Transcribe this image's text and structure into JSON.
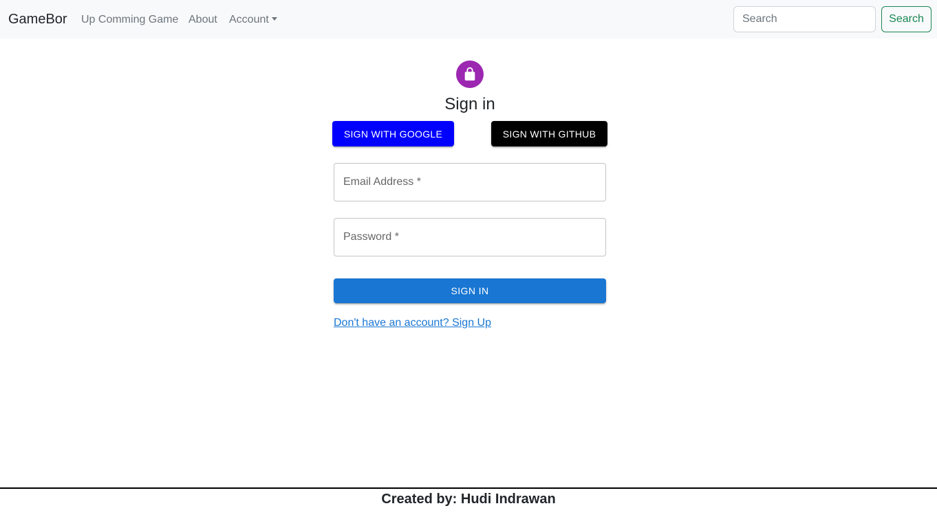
{
  "navbar": {
    "brand": "GameBor",
    "links": [
      {
        "label": "Up Comming Game"
      },
      {
        "label": "About"
      }
    ],
    "account_label": "Account",
    "search": {
      "placeholder": "Search",
      "value": "",
      "button_label": "Search",
      "button_color": "#198754"
    },
    "background_color": "#f8f9fa"
  },
  "signin": {
    "icon": "lock-icon",
    "icon_background": "#9c27b0",
    "title": "Sign in",
    "google_button_label": "SIGN WITH GOOGLE",
    "google_button_color": "#0000ff",
    "github_button_label": "SIGN WITH GITHUB",
    "github_button_color": "#000000",
    "email_label": "Email Address *",
    "email_value": "",
    "password_label": "Password *",
    "password_value": "",
    "submit_label": "SIGN IN",
    "submit_color": "#1976d2",
    "signup_link": "Don't have an account? Sign Up"
  },
  "footer": {
    "text": "Created by: Hudi Indrawan"
  }
}
